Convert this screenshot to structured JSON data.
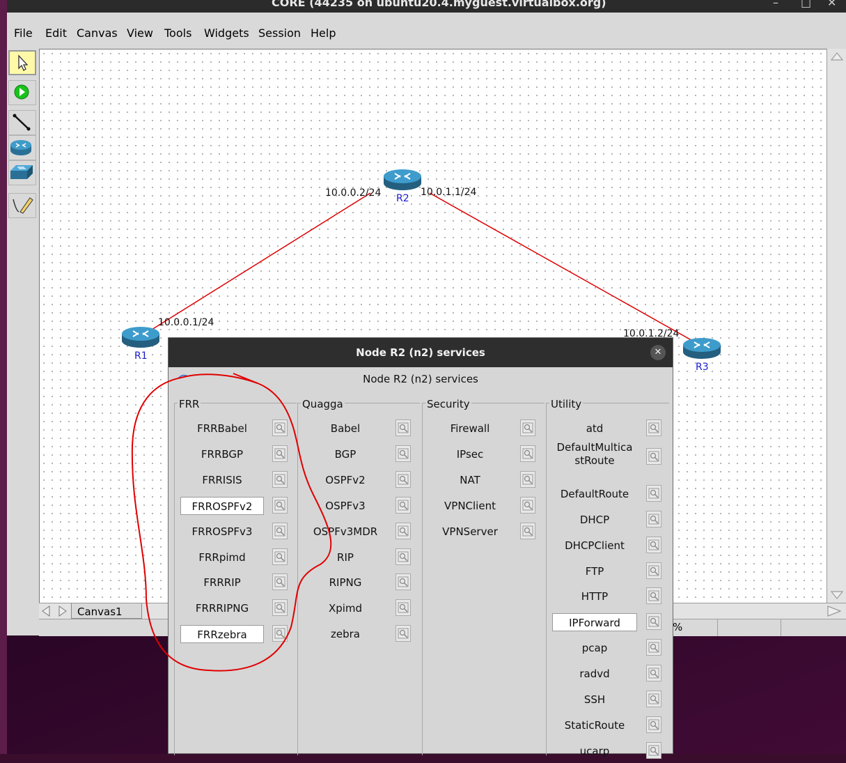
{
  "window": {
    "title": "CORE (44235 on ubuntu20.4.myguest.virtualbox.org)",
    "controls": [
      "–",
      "□",
      "✕"
    ]
  },
  "menu": [
    "File",
    "Edit",
    "Canvas",
    "View",
    "Tools",
    "Widgets",
    "Session",
    "Help"
  ],
  "toolbar": {
    "tools": [
      "select-icon",
      "start-icon",
      "link-icon",
      "router-icon",
      "switch-icon",
      "annotate-icon"
    ]
  },
  "canvas": {
    "tab_label": "Canvas1",
    "routers": [
      {
        "name": "R1"
      },
      {
        "name": "R2"
      },
      {
        "name": "R3"
      }
    ],
    "addresses": [
      "10.0.0.2/24",
      "10.0.1.1/24",
      "10.0.0.1/24",
      "10.0.1.2/24"
    ],
    "link_color": "#dd0000",
    "router_label_color": "#1a1ad0"
  },
  "statusbar": {
    "zoom_suffix": "%"
  },
  "dialog": {
    "titlebar": "Node R2 (n2) services",
    "header": "Node R2 (n2) services",
    "groups": [
      {
        "title": "FRR",
        "services": [
          "FRRBabel",
          "FRRBGP",
          "FRRISIS",
          "FRROSPFv2",
          "FRROSPFv3",
          "FRRpimd",
          "FRRRIP",
          "FRRRIPNG",
          "FRRzebra"
        ],
        "selected": [
          "FRROSPFv2",
          "FRRzebra"
        ]
      },
      {
        "title": "Quagga",
        "services": [
          "Babel",
          "BGP",
          "OSPFv2",
          "OSPFv3",
          "OSPFv3MDR",
          "RIP",
          "RIPNG",
          "Xpimd",
          "zebra"
        ],
        "selected": []
      },
      {
        "title": "Security",
        "services": [
          "Firewall",
          "IPsec",
          "NAT",
          "VPNClient",
          "VPNServer"
        ],
        "selected": []
      },
      {
        "title": "Utility",
        "services": [
          "atd",
          "DefaultMulticastRoute",
          "DefaultRoute",
          "DHCP",
          "DHCPClient",
          "FTP",
          "HTTP",
          "IPForward",
          "pcap",
          "radvd",
          "SSH",
          "StaticRoute",
          "ucarp"
        ],
        "selected": [
          "IPForward"
        ]
      }
    ],
    "annotation_color": "#e00000"
  }
}
